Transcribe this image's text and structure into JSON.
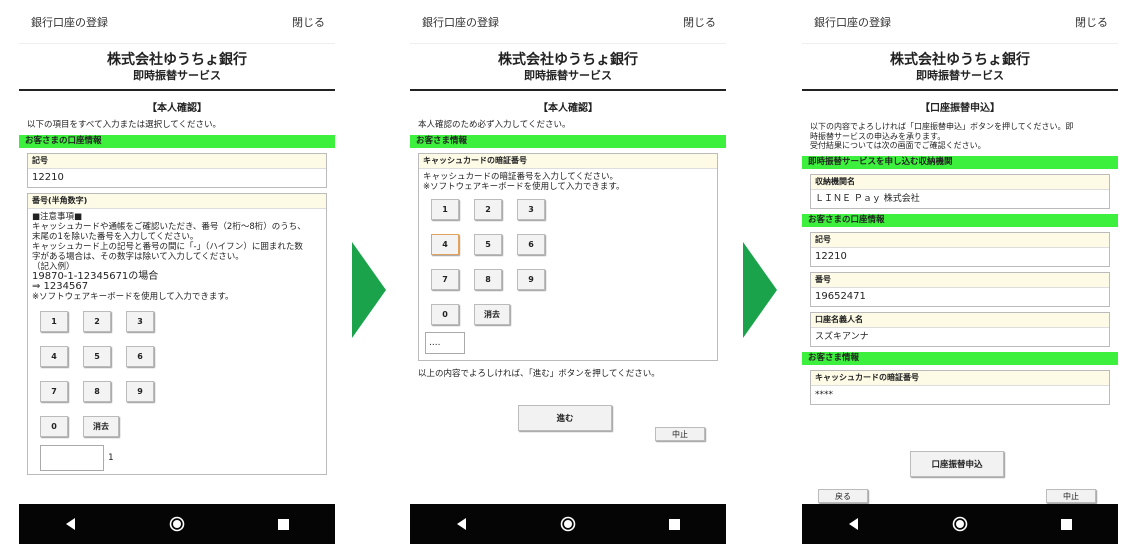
{
  "common": {
    "window_title": "銀行口座の登録",
    "close_label": "閉じる",
    "bank_name": "株式会社ゆうちょ銀行",
    "service_name": "即時振替サービス"
  },
  "screen1": {
    "section_title": "【本人確認】",
    "intro": "以下の項目をすべて入力または選択してください。",
    "account_bar": "お客さまの口座情報",
    "kigo_label": "記号",
    "kigo_value": "12210",
    "bango_label": "番号(半角数字)",
    "notes": [
      "■注意事項■",
      "キャッシュカードや通帳をご確認いただき、番号（2桁～8桁）のうち、",
      "末尾の1を除いた番号を入力してください。",
      "キャッシュカード上の記号と番号の間に「-」（ハイフン）に囲まれた数",
      "字がある場合は、その数字は除いて入力してください。",
      "（記入例）",
      "19870-1-12345671の場合",
      "⇒ 1234567",
      "※ソフトウェアキーボードを使用して入力できます。"
    ],
    "keys": [
      "1",
      "2",
      "3",
      "4",
      "5",
      "6",
      "7",
      "8",
      "9",
      "0"
    ],
    "clear_label": "消去",
    "suffix": "1"
  },
  "screen2": {
    "section_title": "【本人確認】",
    "intro": "本人確認のため必ず入力してください。",
    "info_bar": "お客さま情報",
    "pin_label": "キャッシュカードの暗証番号",
    "pin_notes": [
      "キャッシュカードの暗証番号を入力してください。",
      "※ソフトウェアキーボードを使用して入力できます。"
    ],
    "keys": [
      "1",
      "2",
      "3",
      "4",
      "5",
      "6",
      "7",
      "8",
      "9",
      "0"
    ],
    "clear_label": "消去",
    "pin_value": "....",
    "confirm_text": "以上の内容でよろしければ、「進む」ボタンを押してください。",
    "next_label": "進む",
    "cancel_label": "中止"
  },
  "screen3": {
    "section_title": "【口座振替申込】",
    "intro": [
      "以下の内容でよろしければ「口座振替申込」ボタンを押してください。即",
      "時振替サービスの申込みを承ります。",
      "受付結果については次の画面でご確認ください。"
    ],
    "recv_bar": "即時振替サービスを申し込む収納機関",
    "org_label": "収納機関名",
    "org_value": "ＬＩＮＥ Ｐａｙ 株式会社",
    "account_bar": "お客さまの口座情報",
    "kigo_label": "記号",
    "kigo_value": "12210",
    "bango_label": "番号",
    "bango_value": "19652471",
    "name_label": "口座名義人名",
    "name_value": "スズキアンナ",
    "info_bar": "お客さま情報",
    "pin_label": "キャッシュカードの暗証番号",
    "pin_value": "****",
    "apply_label": "口座振替申込",
    "back_label": "戻る",
    "cancel_label": "中止"
  },
  "colors": {
    "green_bar": "#3ef03e",
    "arrow_green": "#1aa34a",
    "nav_bg": "#050505"
  }
}
